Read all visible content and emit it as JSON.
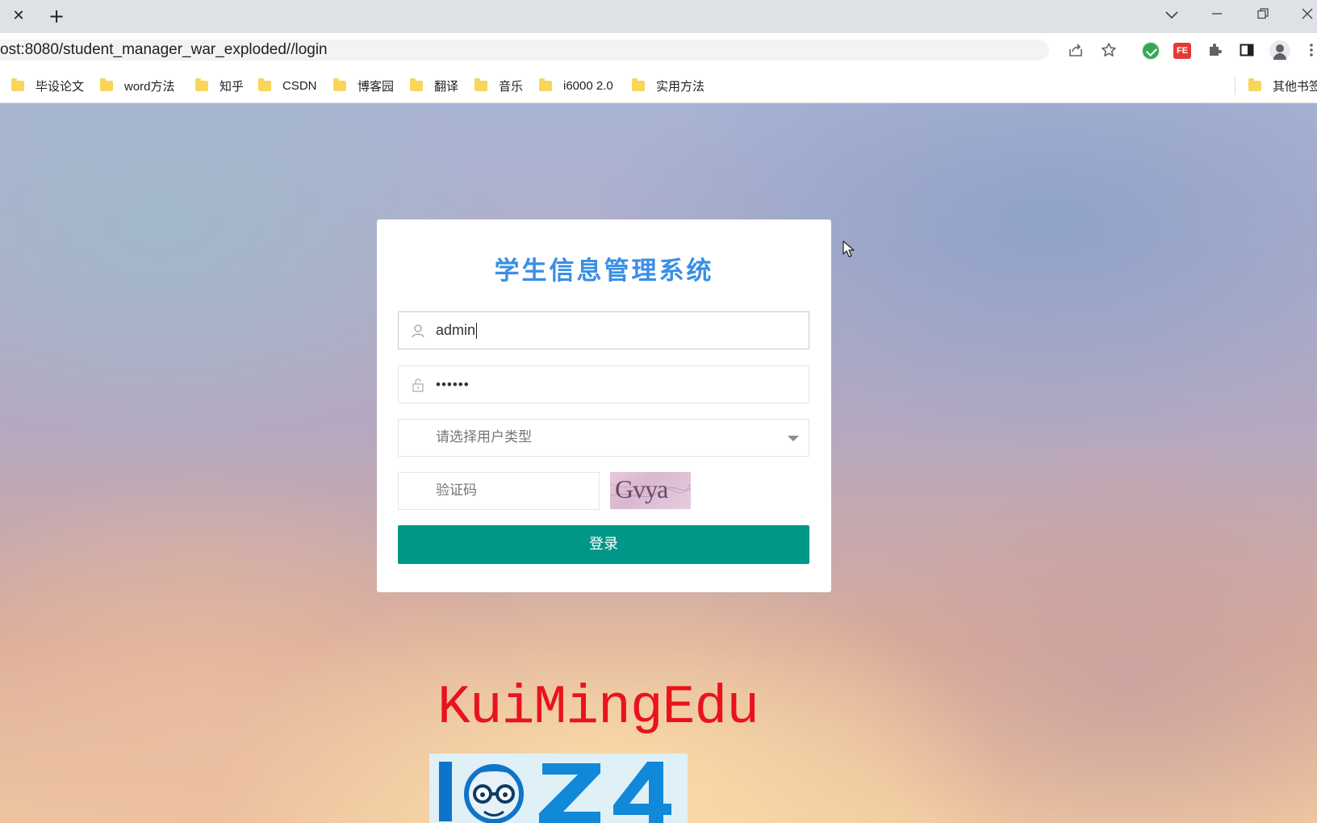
{
  "browser": {
    "tab_close_glyph": "✕",
    "new_tab_glyph": "+",
    "url": "ost:8080/student_manager_war_exploded//login",
    "bookmarks": [
      {
        "label": "毕设论文"
      },
      {
        "label": "word方法"
      },
      {
        "label": "知乎"
      },
      {
        "label": "CSDN"
      },
      {
        "label": "博客园"
      },
      {
        "label": "翻译"
      },
      {
        "label": "音乐"
      },
      {
        "label": "i6000 2.0"
      },
      {
        "label": "实用方法"
      }
    ],
    "other_bookmarks": "其他书签",
    "extension_fe_label": "FE",
    "icons": [
      "share-icon",
      "star-icon",
      "shield-extension-icon",
      "fe-extension-icon",
      "puzzle-icon",
      "sidepanel-icon",
      "profile-icon",
      "menu-icon"
    ]
  },
  "login": {
    "title": "学生信息管理系统",
    "username_value": "admin",
    "password_value": "••••••",
    "user_type_placeholder": "请选择用户类型",
    "captcha_placeholder": "验证码",
    "captcha_image_text": "Gvya",
    "submit_label": "登录"
  },
  "watermark": {
    "text": "KuiMingEdu",
    "logo_text": "IOZ4"
  },
  "colors": {
    "title_blue": "#3a8ee6",
    "button_teal": "#009688",
    "watermark_red": "#e8131d"
  }
}
